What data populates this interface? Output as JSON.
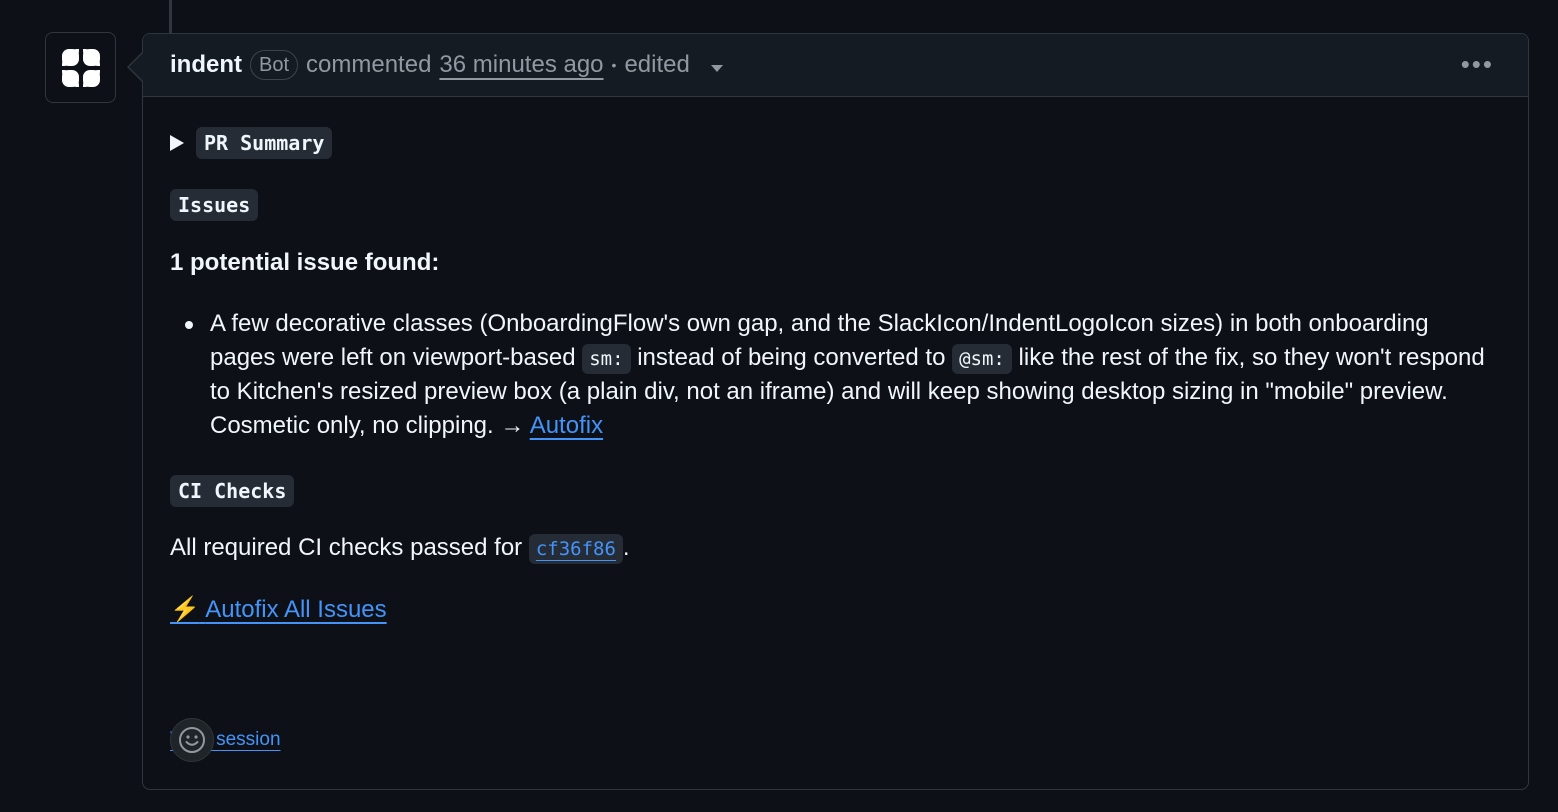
{
  "comment": {
    "author": "indent",
    "badge": "Bot",
    "action": "commented",
    "timestamp": "36 minutes ago",
    "separator": "•",
    "edited": "edited",
    "more_options": "•••"
  },
  "summary": {
    "label": "PR Summary"
  },
  "issues": {
    "heading": "Issues",
    "count_text": "1 potential issue found:",
    "items": [
      {
        "text_part1": "A few decorative classes (OnboardingFlow's own gap, and the SlackIcon/IndentLogoIcon sizes) in both onboarding pages were left on viewport-based",
        "code1": "sm:",
        "text_part2": "instead of being converted to",
        "code2": "@sm:",
        "text_part3": "like the rest of the fix, so they won't respond to Kitchen's resized preview box (a plain div, not an iframe) and will keep showing desktop sizing in \"mobile\" preview. Cosmetic only, no clipping. →",
        "link": "Autofix"
      }
    ]
  },
  "ci": {
    "heading": "CI Checks",
    "text": "All required CI checks passed for",
    "sha": "cf36f86",
    "period": "."
  },
  "autofix_all": {
    "icon": "⚡",
    "label": "Autofix All Issues"
  },
  "view_session": "View session",
  "icons": {
    "avatar": "indent-logo-icon",
    "details": "triangle-right-icon",
    "reaction": "smiley-icon"
  },
  "colors": {
    "background": "#0d1117",
    "header": "#151b23",
    "border": "#30363d",
    "link": "#4493f8",
    "muted": "#9198a1"
  }
}
